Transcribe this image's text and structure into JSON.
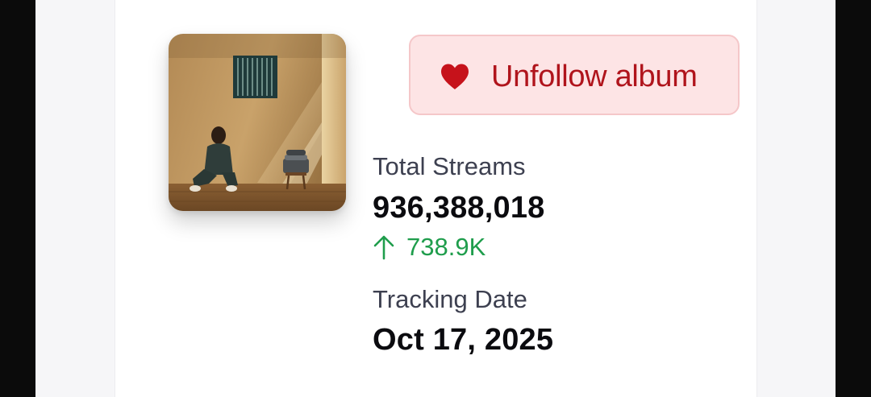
{
  "album": {
    "cover_alt": "Album cover"
  },
  "follow_button": {
    "label": "Unfollow album",
    "icon": "heart-icon",
    "color": "#b0141c",
    "background": "#fde4e5"
  },
  "stats": {
    "total_streams": {
      "label": "Total Streams",
      "value": "936,388,018",
      "delta": "738.9K",
      "delta_icon": "arrow-up-icon",
      "delta_color": "#1f9d4c"
    },
    "tracking_date": {
      "label": "Tracking Date",
      "value": "Oct 17, 2025"
    }
  }
}
